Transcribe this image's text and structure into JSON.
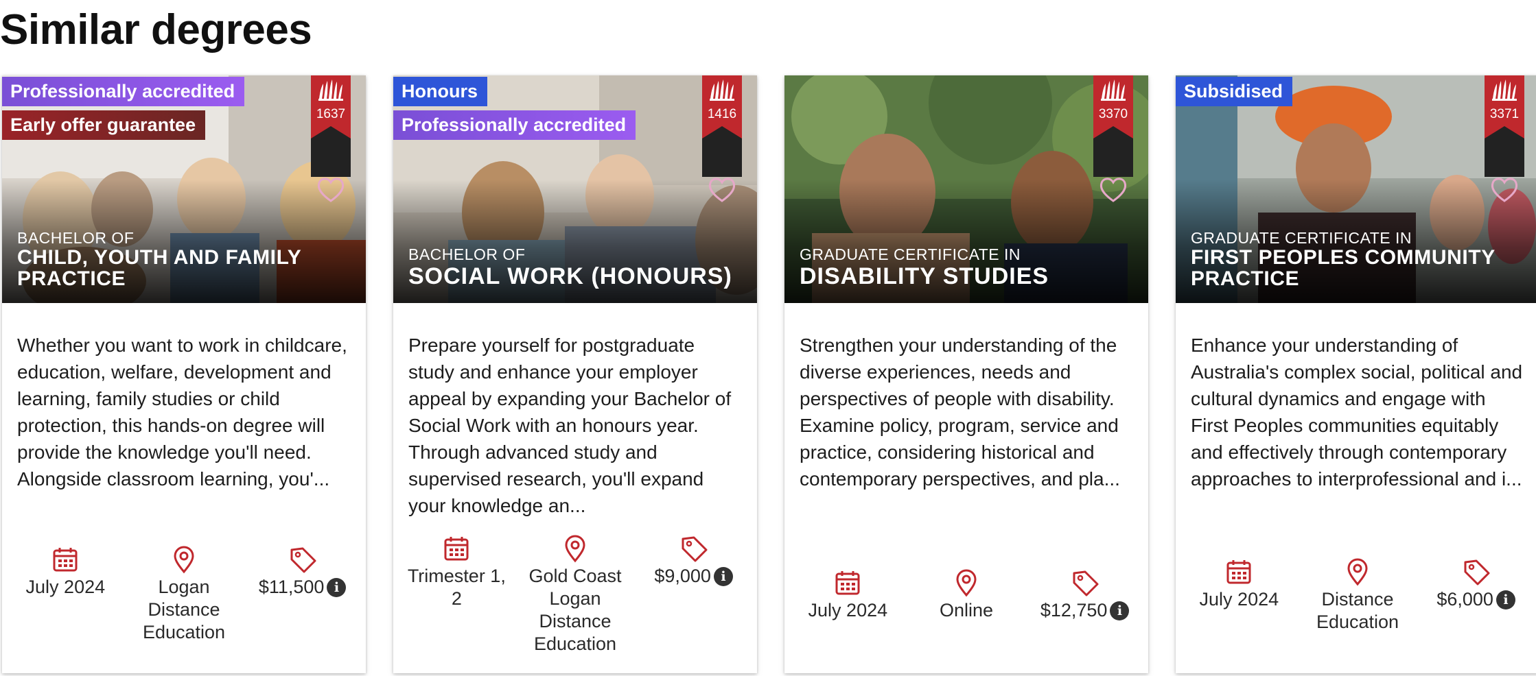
{
  "page": {
    "title": "Similar degrees"
  },
  "colors": {
    "accent": "#c0282d",
    "badge_purple": "#8c56e6",
    "badge_red": "#8a2326",
    "badge_blue": "#2e55d8"
  },
  "icons": {
    "intake": "calendar-icon",
    "location": "map-pin-icon",
    "fee": "price-tag-icon",
    "fee_info": "info-icon",
    "favourite": "heart-icon",
    "logo": "university-logo-icon"
  },
  "cards": [
    {
      "badges": [
        "Professionally accredited",
        "Early offer guarantee"
      ],
      "code": "1637",
      "pre": "BACHELOR OF",
      "name": "CHILD, YOUTH AND FAMILY PRACTICE",
      "description": "Whether you want to work in childcare, education, welfare, development and learning, family studies or child protection, this hands-on degree will provide the knowledge you'll need. Alongside classroom learning, you'...",
      "intake": "July 2024",
      "location": "Logan Distance Education",
      "fee": "$11,500",
      "fee_info_label": "i"
    },
    {
      "badges": [
        "Honours",
        "Professionally accredited"
      ],
      "code": "1416",
      "pre": "BACHELOR OF",
      "name": "SOCIAL WORK (HONOURS)",
      "description": "Prepare yourself for postgraduate study and enhance your employer appeal by expanding your Bachelor of Social Work with an honours year. Through advanced study and supervised research, you'll expand your knowledge an...",
      "intake": "Trimester 1, 2",
      "location": "Gold Coast Logan Distance Education",
      "fee": "$9,000",
      "fee_info_label": "i"
    },
    {
      "badges": [],
      "code": "3370",
      "pre": "GRADUATE CERTIFICATE IN",
      "name": "DISABILITY STUDIES",
      "description": "Strengthen your understanding of the diverse experiences, needs and perspectives of people with disability. Examine policy, program, service and practice, considering historical and contemporary perspectives, and pla...",
      "intake": "July 2024",
      "location": "Online",
      "fee": "$12,750",
      "fee_info_label": "i"
    },
    {
      "badges": [
        "Subsidised"
      ],
      "code": "3371",
      "pre": "GRADUATE CERTIFICATE IN",
      "name": "FIRST PEOPLES COMMUNITY PRACTICE",
      "description": "Enhance your understanding of Australia's complex social, political and cultural dynamics and engage with First Peoples communities equitably and effectively through contemporary approaches to interprofessional and i...",
      "intake": "July 2024",
      "location": "Distance Education",
      "fee": "$6,000",
      "fee_info_label": "i"
    }
  ]
}
